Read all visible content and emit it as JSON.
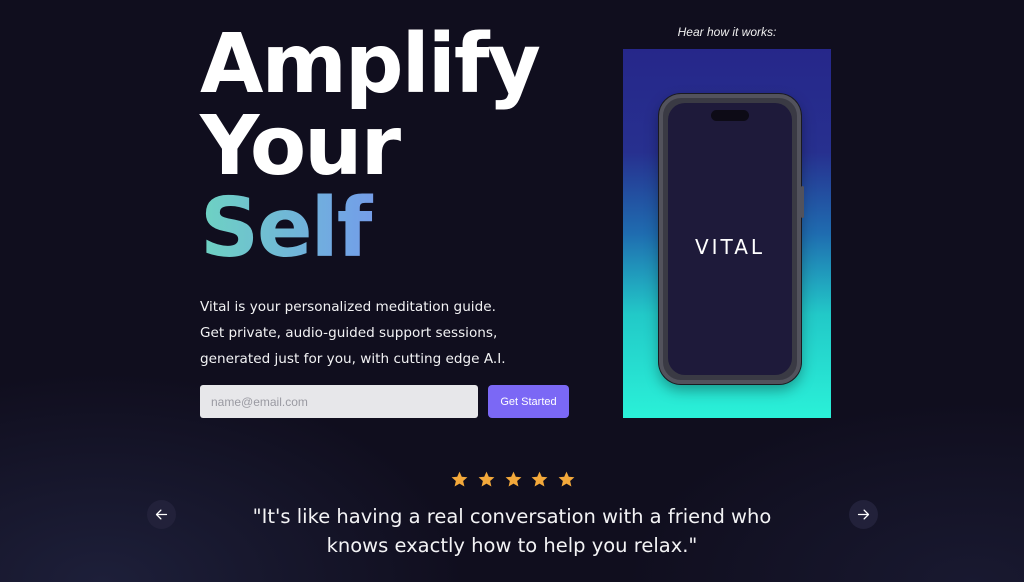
{
  "hero": {
    "headline_line1": "Amplify",
    "headline_line2": "Your",
    "headline_line3": "Self",
    "description_line1": "Vital is your personalized meditation guide.",
    "description_line2": "Get private, audio-guided support sessions,",
    "description_line3": "generated just for you, with cutting edge A.I."
  },
  "signup": {
    "email_placeholder": "name@email.com",
    "email_value": "",
    "button_label": "Get Started"
  },
  "video": {
    "caption": "Hear how it works:",
    "logo_text": "VITAL"
  },
  "testimonial": {
    "rating": 5,
    "rating_max": 5,
    "quote_line1": "\"It's like having a real conversation with a friend who",
    "quote_line2": "knows exactly how to help you relax.\""
  },
  "icons": {
    "prev": "arrow-left-icon",
    "next": "arrow-right-icon",
    "star": "star-icon"
  },
  "colors": {
    "background": "#100e1e",
    "accent_button": "#7b68f5",
    "star": "#f4a93b",
    "headline_gradient_start": "#6ed3c2",
    "headline_gradient_end": "#8f6cf0"
  }
}
